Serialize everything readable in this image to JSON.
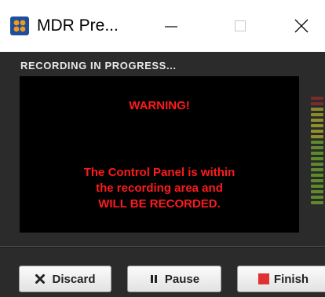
{
  "window": {
    "title": "MDR Pre...",
    "icon": "app-logo-icon",
    "controls": [
      "minimize-icon",
      "maximize-icon",
      "close-icon"
    ]
  },
  "status": {
    "label": "RECORDING IN PROGRESS..."
  },
  "warning": {
    "title": "WARNING!",
    "lines": [
      "The Control Panel is within",
      "the recording area and",
      "WILL BE RECORDED."
    ],
    "color": "#ff1a1a"
  },
  "meter": {
    "icon": "audio-level-meter",
    "colors": [
      "#7a2b2b",
      "#7a2b2b",
      "#8a8a2b",
      "#8a8a2b",
      "#8f8f2c",
      "#8f8f2c",
      "#8f8f2c",
      "#8f8f2c",
      "#5f8a2b",
      "#5f8a2b",
      "#5f8a2b",
      "#5f8a2b",
      "#5f8a2b",
      "#5f8a2b",
      "#5f8a2b",
      "#5f8a2b",
      "#5f8a2b",
      "#5f8a2b",
      "#5f8a2b",
      "#5f8a2b"
    ]
  },
  "actions": {
    "discard": {
      "label": "Discard",
      "icon": "x-icon"
    },
    "pause": {
      "label": "Pause",
      "icon": "pause-icon"
    },
    "finish": {
      "label": "Finish",
      "icon": "stop-square-icon",
      "icon_color": "#e03030"
    }
  }
}
